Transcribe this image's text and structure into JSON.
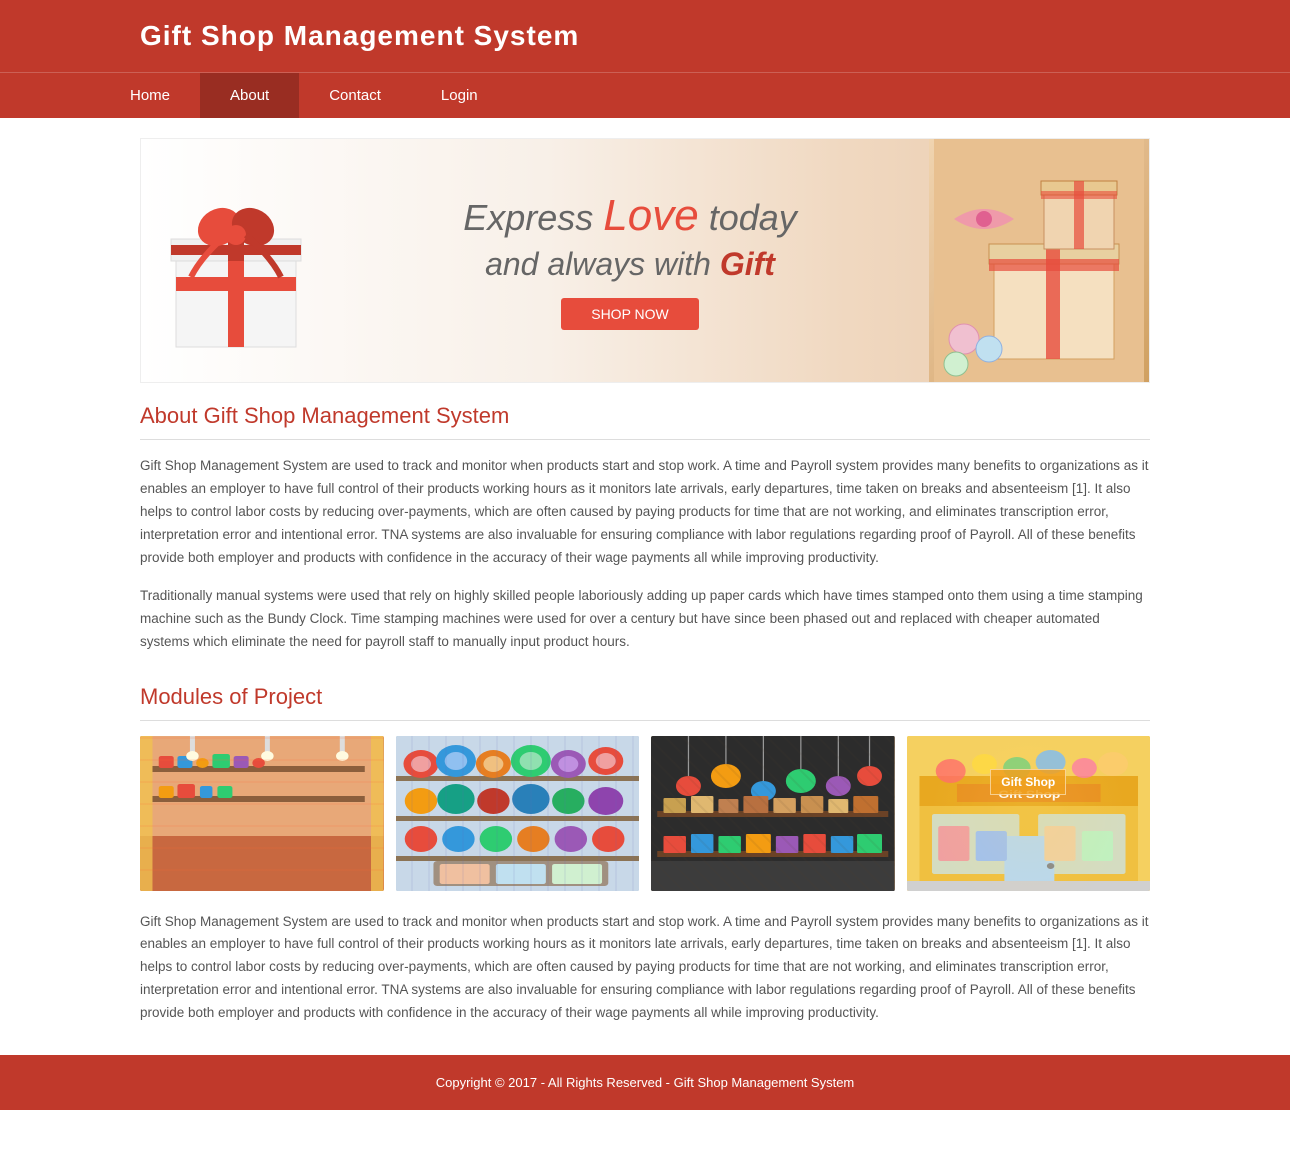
{
  "header": {
    "title": "Gift Shop Management System",
    "bg_color": "#c0392b"
  },
  "nav": {
    "items": [
      {
        "label": "Home",
        "active": false
      },
      {
        "label": "About",
        "active": true
      },
      {
        "label": "Contact",
        "active": false
      },
      {
        "label": "Login",
        "active": false
      }
    ]
  },
  "banner": {
    "line1_prefix": "Express ",
    "line1_highlight": "Love",
    "line1_suffix": " today",
    "line2_prefix": "and always with ",
    "line2_highlight": "Gift",
    "shop_now": "SHOP NOW"
  },
  "about_section": {
    "title": "About Gift Shop Management System",
    "para1": "Gift Shop Management System are used to track and monitor when products start and stop work. A time and Payroll system provides many benefits to organizations as it enables an employer to have full control of their products working hours as it monitors late arrivals, early departures, time taken on breaks and absenteeism [1]. It also helps to control labor costs by reducing over-payments, which are often caused by paying products for time that are not working, and eliminates transcription error, interpretation error and intentional error. TNA systems are also invaluable for ensuring compliance with labor regulations regarding proof of Payroll. All of these benefits provide both employer and products with confidence in the accuracy of their wage payments all while improving productivity.",
    "para2": "Traditionally manual systems were used that rely on highly skilled people laboriously adding up paper cards which have times stamped onto them using a time stamping machine such as the Bundy Clock. Time stamping machines were used for over a century but have since been phased out and replaced with cheaper automated systems which eliminate the need for payroll staff to manually input product hours."
  },
  "modules_section": {
    "title": "Modules of Project",
    "images": [
      {
        "alt": "Gift shop interior 1",
        "label": ""
      },
      {
        "alt": "Gift shop interior 2",
        "label": ""
      },
      {
        "alt": "Gift shop interior 3",
        "label": ""
      },
      {
        "alt": "Gilt Shop exterior",
        "label": "Gift Shop"
      }
    ]
  },
  "bottom_section": {
    "para1": "Gift Shop Management System are used to track and monitor when products start and stop work. A time and Payroll system provides many benefits to organizations as it enables an employer to have full control of their products working hours as it monitors late arrivals, early departures, time taken on breaks and absenteeism [1]. It also helps to control labor costs by reducing over-payments, which are often caused by paying products for time that are not working, and eliminates transcription error, interpretation error and intentional error. TNA systems are also invaluable for ensuring compliance with labor regulations regarding proof of Payroll. All of these benefits provide both employer and products with confidence in the accuracy of their wage payments all while improving productivity."
  },
  "footer": {
    "text": "Copyright © 2017 - All Rights Reserved - Gift Shop Management System"
  }
}
